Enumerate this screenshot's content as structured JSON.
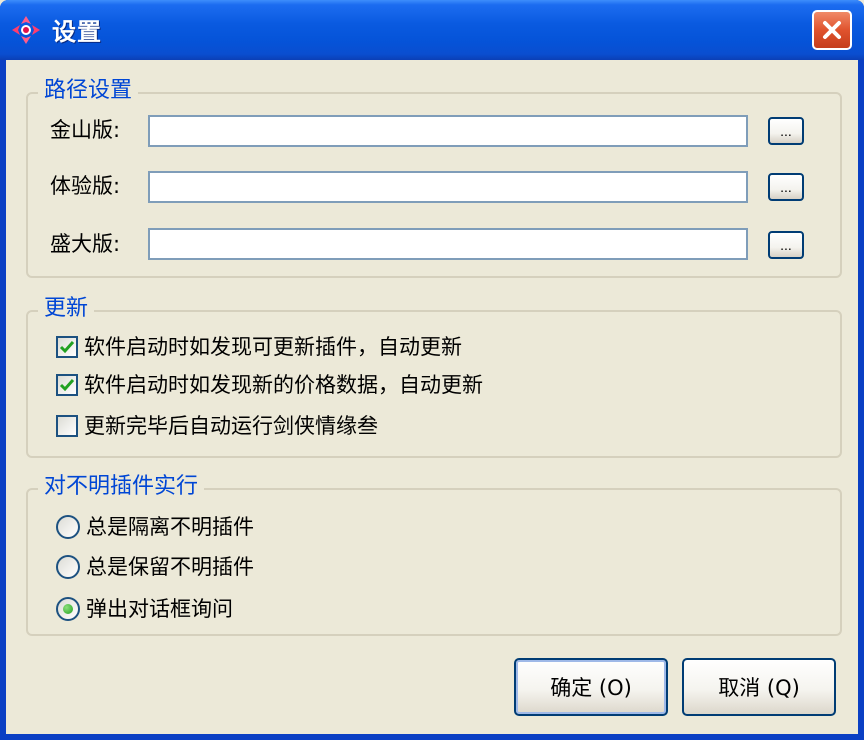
{
  "window": {
    "title": "设置",
    "icon": "app-logo-icon",
    "close_icon": "close-icon"
  },
  "path_settings": {
    "title": "路径设置",
    "rows": [
      {
        "label": "金山版:",
        "value": "",
        "browse_label": "..."
      },
      {
        "label": "体验版:",
        "value": "",
        "browse_label": "..."
      },
      {
        "label": "盛大版:",
        "value": "",
        "browse_label": "..."
      }
    ]
  },
  "update": {
    "title": "更新",
    "options": [
      {
        "label": "软件启动时如发现可更新插件，自动更新",
        "checked": true
      },
      {
        "label": "软件启动时如发现新的价格数据，自动更新",
        "checked": true
      },
      {
        "label": "更新完毕后自动运行剑侠情缘叁",
        "checked": false
      }
    ]
  },
  "unknown_plugins": {
    "title": "对不明插件实行",
    "options": [
      {
        "label": "总是隔离不明插件",
        "selected": false
      },
      {
        "label": "总是保留不明插件",
        "selected": false
      },
      {
        "label": "弹出对话框询问",
        "selected": true
      }
    ]
  },
  "buttons": {
    "ok": "确定 (O)",
    "cancel": "取消 (Q)"
  },
  "colors": {
    "titlebar": "#0553d8",
    "group_title": "#0046d5",
    "close_button": "#e0532e",
    "check_mark": "#21a121"
  }
}
